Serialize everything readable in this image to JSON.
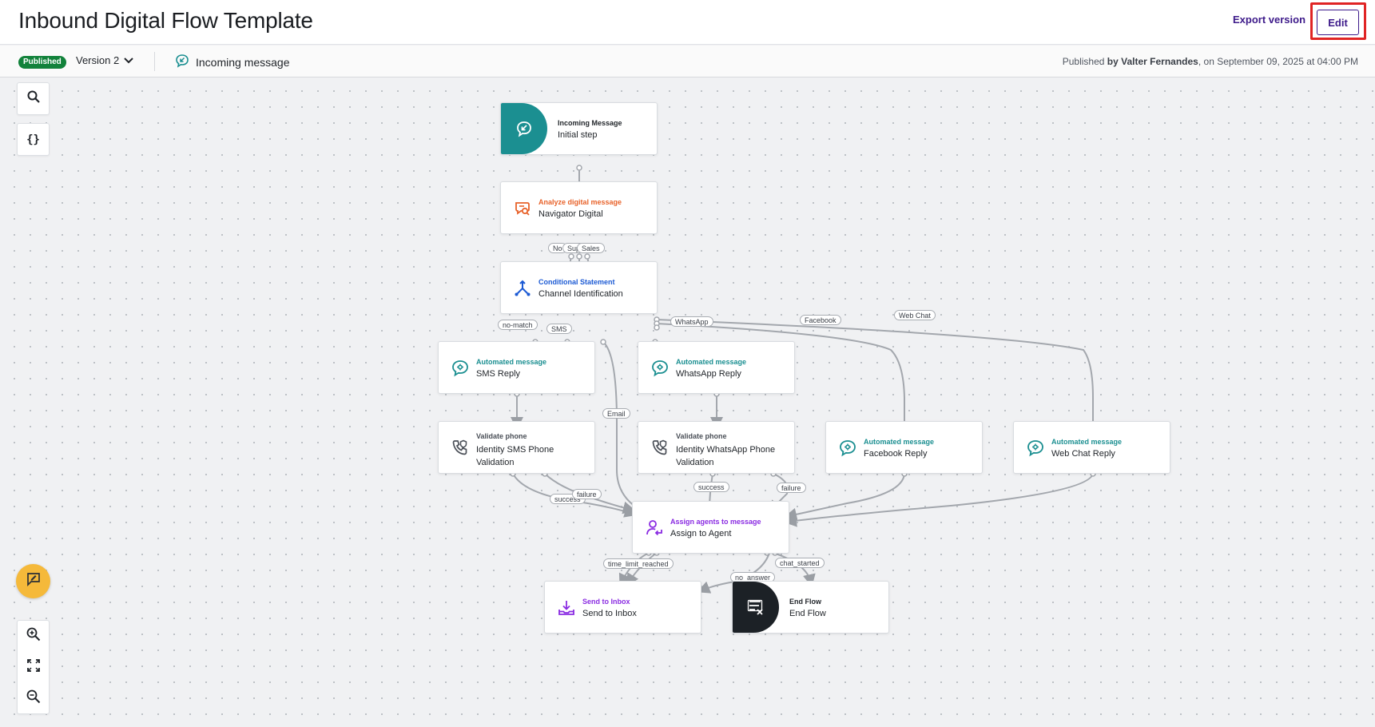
{
  "header": {
    "title": "Inbound Digital Flow Template",
    "export_label": "Export version",
    "edit_label": "Edit"
  },
  "subbar": {
    "status_badge": "Published",
    "version": "Version 2",
    "trigger": "Incoming message",
    "published_prefix": "Published",
    "published_by_word": "by",
    "published_by": "Valter Fernandes",
    "published_on": ", on September 09, 2025 at 04:00 PM"
  },
  "toolbar": {
    "search_icon": "search-icon",
    "variables_icon": "curly-braces-icon",
    "variables_label": "{}",
    "feedback_icon": "chat-feedback-icon",
    "zoom_in_icon": "zoom-in-icon",
    "fit_icon": "fit-screen-icon",
    "zoom_out_icon": "zoom-out-icon"
  },
  "colors": {
    "brand": "#3d1a8a",
    "highlight": "#e02424",
    "published": "#12823b",
    "teal": "#1b8f91",
    "orange": "#e8622a",
    "blue": "#1c5ad4",
    "purple": "#8a2be2",
    "end": "#1c2126",
    "feedback": "#f5b93a"
  },
  "nodes": {
    "incoming": {
      "type": "Incoming Message",
      "name": "Initial step",
      "icon": "incoming-message-icon"
    },
    "analyze": {
      "type": "Analyze digital message",
      "name": "Navigator Digital",
      "icon": "analyze-message-icon"
    },
    "conditional": {
      "type": "Conditional Statement",
      "name": "Channel Identification",
      "icon": "branch-icon"
    },
    "sms_reply": {
      "type": "Automated message",
      "name": "SMS Reply",
      "icon": "automated-message-icon"
    },
    "whatsapp_reply": {
      "type": "Automated message",
      "name": "WhatsApp Reply",
      "icon": "automated-message-icon"
    },
    "sms_validation": {
      "type": "Validate phone",
      "name": "Identity SMS Phone Validation",
      "icon": "phone-validate-icon"
    },
    "whatsapp_validation": {
      "type": "Validate phone",
      "name": "Identity WhatsApp Phone Validation",
      "icon": "phone-validate-icon"
    },
    "facebook_reply": {
      "type": "Automated message",
      "name": "Facebook Reply",
      "icon": "automated-message-icon"
    },
    "webchat_reply": {
      "type": "Automated message",
      "name": "Web Chat Reply",
      "icon": "automated-message-icon"
    },
    "assign": {
      "type": "Assign agents to message",
      "name": "Assign to Agent",
      "icon": "assign-agent-icon"
    },
    "inbox": {
      "type": "Send to Inbox",
      "name": "Send to Inbox",
      "icon": "inbox-icon"
    },
    "end": {
      "type": "End Flow",
      "name": "End Flow",
      "icon": "end-flow-icon"
    }
  },
  "edge_labels": {
    "no": "No",
    "sup": "Sup",
    "sales": "Sales",
    "no_match": "no-match",
    "sms": "SMS",
    "whatsapp": "WhatsApp",
    "facebook": "Facebook",
    "web_chat": "Web Chat",
    "email": "Email",
    "success_sms": "success",
    "failure_sms": "failure",
    "success_wa": "success",
    "failure_wa": "failure",
    "time_limit": "time_limit_reached",
    "no_answer": "no_answer",
    "chat_started": "chat_started"
  }
}
